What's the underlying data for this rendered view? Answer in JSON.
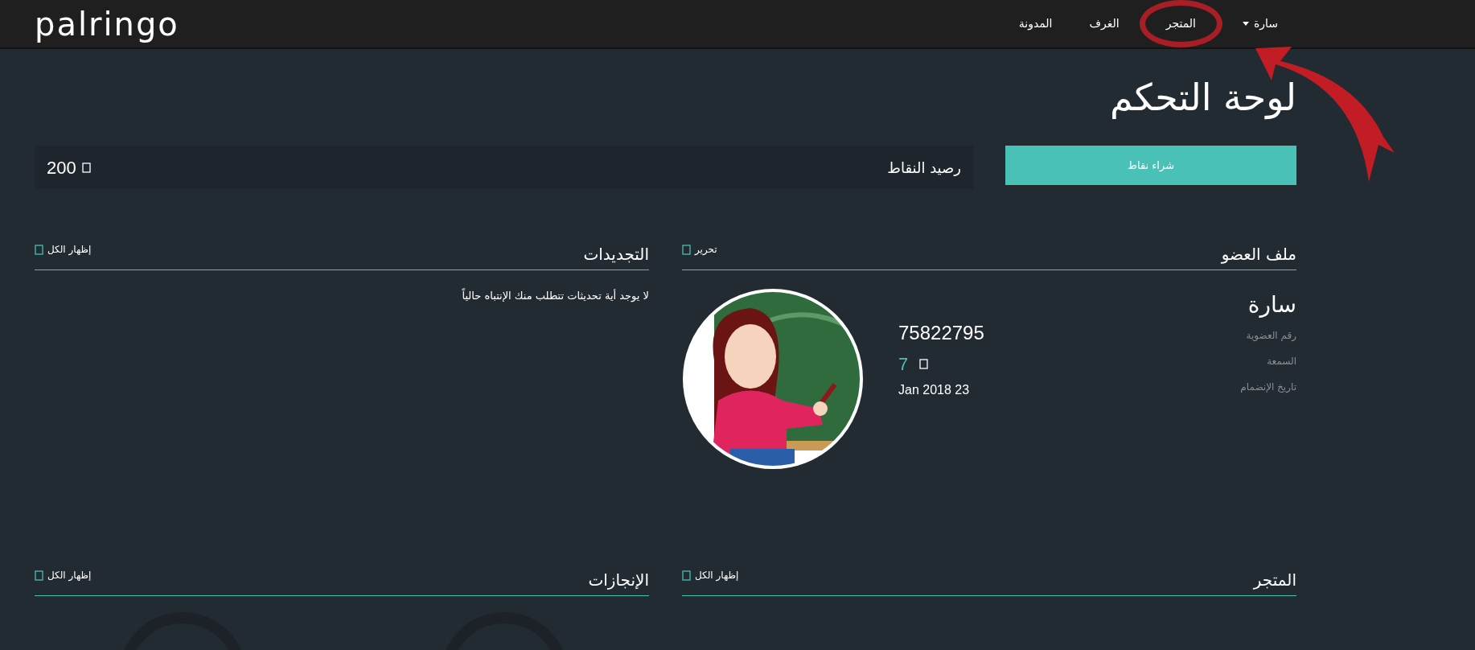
{
  "nav": {
    "logo": "palringo",
    "items": [
      {
        "label": "سارة",
        "kind": "user-menu",
        "circled": false
      },
      {
        "label": "المتجر",
        "kind": "link",
        "circled": true
      },
      {
        "label": "الغرف",
        "kind": "link",
        "circled": false
      },
      {
        "label": "المدونة",
        "kind": "link",
        "circled": false
      }
    ]
  },
  "page_title": "لوحة التحكم",
  "points": {
    "button": "شراء نقاط",
    "label": "رصيد النقاط",
    "value": "200"
  },
  "profile": {
    "title": "ملف العضو",
    "action": "تحرير",
    "name": "سارة",
    "fields": [
      {
        "label": "رقم العضوية",
        "value": "75822795",
        "kind": "id"
      },
      {
        "label": "السمعة",
        "value": "7",
        "kind": "reputation"
      },
      {
        "label": "تاريخ الإنضمام",
        "value": "Jan 2018 23",
        "kind": "date"
      }
    ]
  },
  "updates": {
    "title": "التجديدات",
    "action": "إظهار الكل",
    "message": "لا يوجد أية تحديثات تتطلب منك الإنتباه حالياً"
  },
  "store": {
    "title": "المتجر",
    "action": "إظهار الكل"
  },
  "achievements": {
    "title": "الإنجازات",
    "action": "إظهار الكل"
  }
}
